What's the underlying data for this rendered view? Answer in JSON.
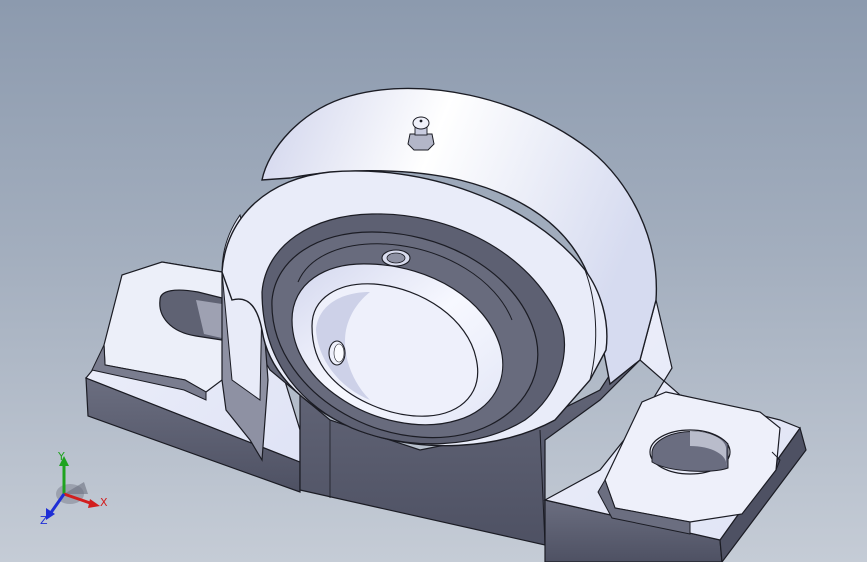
{
  "viewport": {
    "background_top": "#8c9aae",
    "background_bottom": "#c5ccd6"
  },
  "model": {
    "name_icon": "pillow-block-bearing-icon",
    "body_color": "#e6eaf8",
    "shadow_color": "#5f6273",
    "edge_color": "#1b1c24"
  },
  "triad": {
    "x_label": "X",
    "y_label": "Y",
    "z_label": "Z",
    "x_color": "#d21e1e",
    "y_color": "#1fa31f",
    "z_color": "#1f2fd6"
  }
}
